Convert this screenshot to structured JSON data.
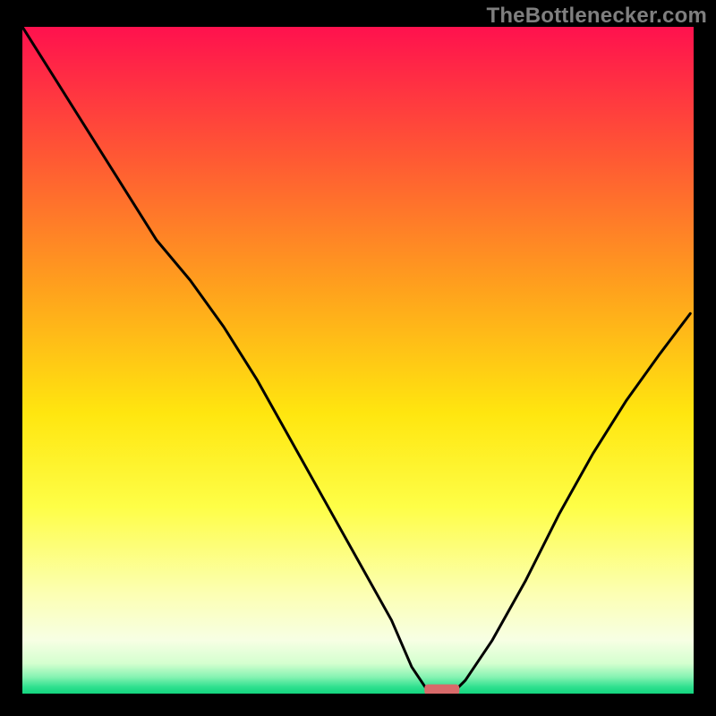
{
  "attribution": "TheBottlenecker.com",
  "chart_data": {
    "type": "line",
    "title": "",
    "xlabel": "",
    "ylabel": "",
    "xlim": [
      0,
      100
    ],
    "ylim": [
      0,
      100
    ],
    "x": [
      0,
      5,
      10,
      15,
      20,
      25,
      30,
      35,
      40,
      45,
      50,
      55,
      58,
      60,
      61.5,
      63,
      64.5,
      66,
      70,
      75,
      80,
      85,
      90,
      95,
      99.5
    ],
    "values": [
      100,
      92,
      84,
      76,
      68,
      62,
      55,
      47,
      38,
      29,
      20,
      11,
      4,
      1,
      0.5,
      0.5,
      0.5,
      2,
      8,
      17,
      27,
      36,
      44,
      51,
      57
    ],
    "gradient_stops": [
      {
        "offset": 0,
        "color": "#ff114e"
      },
      {
        "offset": 0.2,
        "color": "#ff5a33"
      },
      {
        "offset": 0.4,
        "color": "#ffa41c"
      },
      {
        "offset": 0.58,
        "color": "#ffe60f"
      },
      {
        "offset": 0.72,
        "color": "#fefe47"
      },
      {
        "offset": 0.85,
        "color": "#fcffb3"
      },
      {
        "offset": 0.92,
        "color": "#f7ffe4"
      },
      {
        "offset": 0.955,
        "color": "#d4ffcf"
      },
      {
        "offset": 0.975,
        "color": "#86f3b2"
      },
      {
        "offset": 0.99,
        "color": "#2fe08f"
      },
      {
        "offset": 1.0,
        "color": "#13d67e"
      }
    ],
    "marker": {
      "x_center": 62.5,
      "y_center": 0.6,
      "width": 5.2,
      "height": 1.6,
      "color": "#d86a6a"
    }
  }
}
